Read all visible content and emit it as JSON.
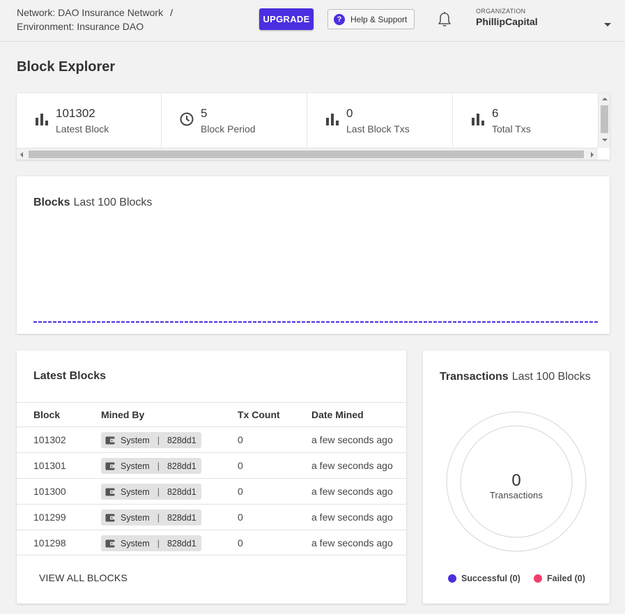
{
  "header": {
    "network_label": "Network: DAO Insurance Network",
    "separator": "/",
    "environment_label": "Environment: Insurance DAO",
    "upgrade_label": "UPGRADE",
    "help_label": "Help & Support",
    "help_glyph": "?",
    "org_label": "ORGANIZATION",
    "org_name": "PhillipCapital"
  },
  "page": {
    "title": "Block Explorer"
  },
  "stats": [
    {
      "value": "101302",
      "label": "Latest Block",
      "icon": "bar-chart-icon"
    },
    {
      "value": "5",
      "label": "Block Period",
      "icon": "clock-icon"
    },
    {
      "value": "0",
      "label": "Last Block Txs",
      "icon": "bar-chart-icon"
    },
    {
      "value": "6",
      "label": "Total Txs",
      "icon": "bar-chart-icon"
    }
  ],
  "blocks_chart": {
    "title": "Blocks",
    "subtitle": "Last 100 Blocks",
    "line_color": "#4a2fe0"
  },
  "latest_blocks": {
    "title": "Latest Blocks",
    "columns": [
      "Block",
      "Mined By",
      "Tx Count",
      "Date Mined"
    ],
    "rows": [
      {
        "block": "101302",
        "miner": "System",
        "hash": "828dd1",
        "tx_count": "0",
        "date": "a few seconds ago"
      },
      {
        "block": "101301",
        "miner": "System",
        "hash": "828dd1",
        "tx_count": "0",
        "date": "a few seconds ago"
      },
      {
        "block": "101300",
        "miner": "System",
        "hash": "828dd1",
        "tx_count": "0",
        "date": "a few seconds ago"
      },
      {
        "block": "101299",
        "miner": "System",
        "hash": "828dd1",
        "tx_count": "0",
        "date": "a few seconds ago"
      },
      {
        "block": "101298",
        "miner": "System",
        "hash": "828dd1",
        "tx_count": "0",
        "date": "a few seconds ago"
      }
    ],
    "pipe": "|",
    "view_all_label": "VIEW ALL BLOCKS"
  },
  "transactions": {
    "title": "Transactions",
    "subtitle": "Last 100 Blocks",
    "count": "0",
    "count_label": "Transactions",
    "successful_label": "Successful (0)",
    "failed_label": "Failed (0)",
    "successful_color": "#4a2fe0",
    "failed_color": "#f0406a"
  },
  "colors": {
    "accent": "#4a2fe0",
    "background": "#f2f2f2"
  }
}
